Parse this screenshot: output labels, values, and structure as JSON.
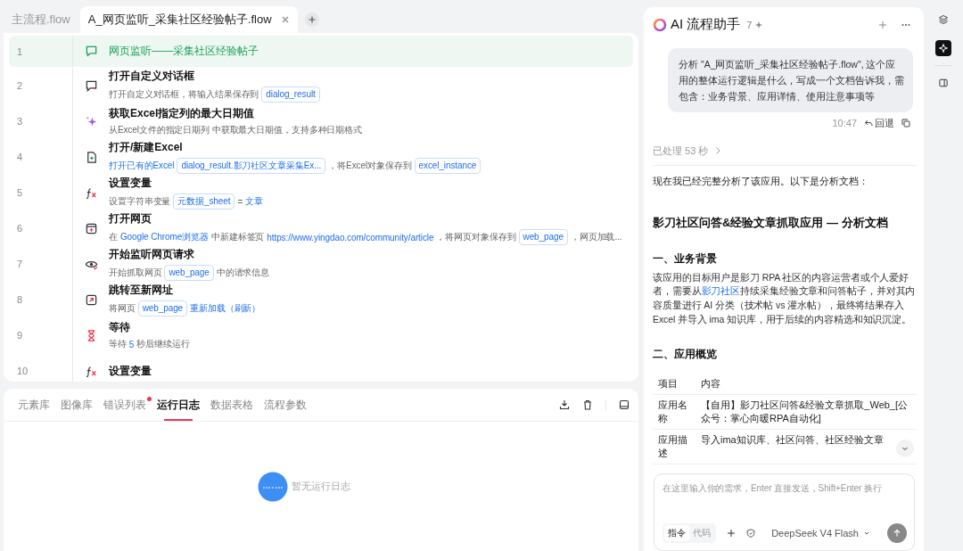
{
  "tabs": [
    {
      "label": "主流程.flow",
      "selected": false
    },
    {
      "label": "A_网页监听_采集社区经验帖子.flow",
      "selected": true
    }
  ],
  "steps": [
    {
      "number": "1",
      "kind": "comment",
      "selected": true,
      "title": "网页监听——采集社区经验帖子"
    },
    {
      "number": "2",
      "kind": "dialog",
      "selected": false,
      "title": "打开自定义对话框",
      "description": [
        {
          "kind": "text",
          "text": "打开自定义对话框，将输入结果保存到"
        },
        {
          "kind": "var",
          "text": "dialog_result"
        }
      ]
    },
    {
      "number": "3",
      "kind": "sparkle",
      "selected": false,
      "title": "获取Excel指定列的最大日期值",
      "description": [
        {
          "kind": "text",
          "text": "从Excel文件的指定日期列  中获取最大日期值，支持多种日期格式"
        }
      ]
    },
    {
      "number": "4",
      "kind": "excel",
      "selected": false,
      "title": "打开/新建Excel",
      "description": [
        {
          "kind": "link",
          "text": "打开已有的Excel"
        },
        {
          "kind": "var",
          "text": "dialog_result.影刀社区文章采集Ex..."
        },
        {
          "kind": "text",
          "text": "，将Excel对象保存到"
        },
        {
          "kind": "var",
          "text": "excel_instance"
        }
      ]
    },
    {
      "number": "5",
      "kind": "function",
      "selected": false,
      "title": "设置变量",
      "description": [
        {
          "kind": "text",
          "text": "设置字符串变量"
        },
        {
          "kind": "var",
          "text": "元数据_sheet"
        },
        {
          "kind": "text",
          "text": "="
        },
        {
          "kind": "link",
          "text": "文章"
        }
      ]
    },
    {
      "number": "6",
      "kind": "browser",
      "selected": false,
      "title": "打开网页",
      "description": [
        {
          "kind": "text",
          "text": "在"
        },
        {
          "kind": "link",
          "text": "Google Chrome浏览器"
        },
        {
          "kind": "text",
          "text": "中新建标签页"
        },
        {
          "kind": "link",
          "text": "https://www.yingdao.com/community/article"
        },
        {
          "kind": "text",
          "text": "，将网页对象保存到"
        },
        {
          "kind": "var",
          "text": "web_page"
        },
        {
          "kind": "text",
          "text": "，网页加载..."
        }
      ]
    },
    {
      "number": "7",
      "kind": "eye",
      "selected": false,
      "title": "开始监听网页请求",
      "description": [
        {
          "kind": "text",
          "text": "开始抓取网页"
        },
        {
          "kind": "var",
          "text": "web_page"
        },
        {
          "kind": "text",
          "text": "中的请求信息"
        }
      ]
    },
    {
      "number": "8",
      "kind": "jump",
      "selected": false,
      "title": "跳转至新网址",
      "description": [
        {
          "kind": "text",
          "text": "将网页"
        },
        {
          "kind": "var",
          "text": "web_page"
        },
        {
          "kind": "link",
          "text": "重新加载（刷新）"
        }
      ]
    },
    {
      "number": "9",
      "kind": "wait",
      "selected": false,
      "title": "等待",
      "description": [
        {
          "kind": "text",
          "text": "等待"
        },
        {
          "kind": "link",
          "text": "5"
        },
        {
          "kind": "text",
          "text": "秒后继续运行"
        }
      ]
    },
    {
      "number": "10",
      "kind": "function",
      "selected": false,
      "title": "设置变量"
    }
  ],
  "bottom_tabs": [
    {
      "label": "元素库",
      "selected": false,
      "badge": false
    },
    {
      "label": "图像库",
      "selected": false,
      "badge": false
    },
    {
      "label": "错误列表",
      "selected": false,
      "badge": true
    },
    {
      "label": "运行日志",
      "selected": true,
      "badge": false
    },
    {
      "label": "数据表格",
      "selected": false,
      "badge": false
    },
    {
      "label": "流程参数",
      "selected": false,
      "badge": false
    }
  ],
  "log_empty": "暂无运行日志",
  "assistant": {
    "title": "AI 流程助手",
    "count": "7",
    "user_message": {
      "text": "分析 \"A_网页监听_采集社区经验帖子.flow\", 这个应用的整体运行逻辑是什么，写成一个文档告诉我，需包含：业务背景、应用详情、使用注意事项等",
      "time": "10:47",
      "revert": "回退"
    },
    "processed": "已处理 53 秒",
    "intro": "现在我已经完整分析了该应用。以下是分析文档：",
    "doc_title": "影刀社区问答&经验文章抓取应用 — 分析文档",
    "section_1": {
      "heading": "一、业务背景",
      "paragraph": [
        {
          "kind": "text",
          "text": "该应用的目标用户是影刀 RPA 社区的内容运营者或个人爱好者，需要从"
        },
        {
          "kind": "link",
          "text": "影刀社区"
        },
        {
          "kind": "text",
          "text": "持续采集经验文章和问答帖子，并对其内容质量进行 AI 分类（技术帖 vs 灌水帖），最终将结果存入 Excel 并导入 ima 知识库，用于后续的内容精选和知识沉淀。"
        }
      ]
    },
    "section_2": {
      "heading": "二、应用概览",
      "table": {
        "columns": [
          "项目",
          "内容"
        ],
        "rows": [
          [
            "应用名称",
            "【自用】影刀社区问答&经验文章抓取_Web_[公众号：掌心向暖RPA自动化]"
          ],
          [
            "应用描述",
            "导入ima知识库、社区问答、社区经验文章"
          ]
        ]
      }
    },
    "input": {
      "placeholder": "在这里输入你的需求，Enter 直接发送，Shift+Enter 换行"
    },
    "modes": [
      {
        "label": "指令",
        "selected": true
      },
      {
        "label": "代码",
        "selected": false
      }
    ],
    "model": "DeepSeek V4 Flash"
  },
  "rail": [
    {
      "kind": "layers",
      "selected": false
    },
    {
      "kind": "sparkle",
      "selected": true
    },
    {
      "kind": "panel",
      "selected": false
    }
  ]
}
